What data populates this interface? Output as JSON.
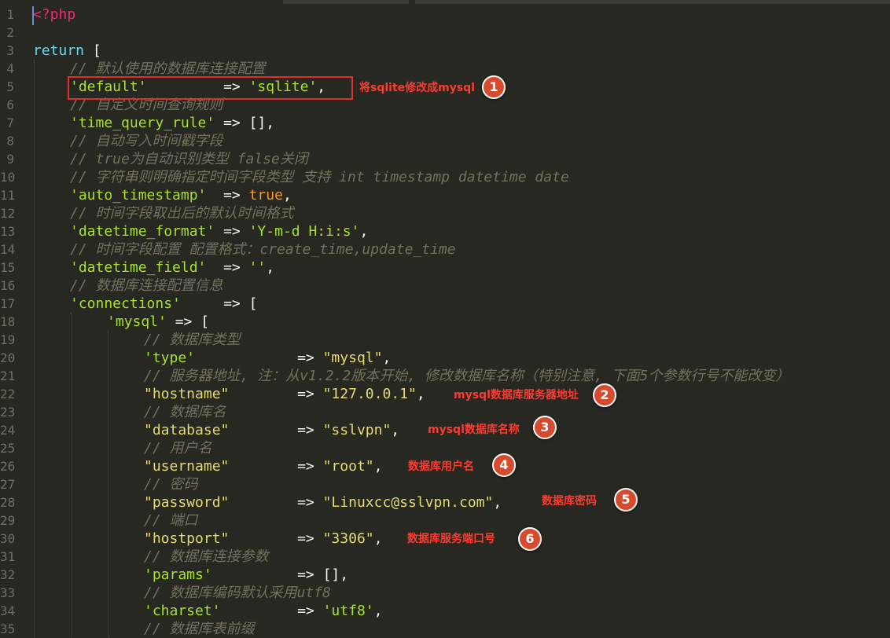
{
  "lines": [
    {
      "n": "1",
      "indent": 0,
      "parts": [
        {
          "t": "<?php",
          "c": "tag"
        }
      ]
    },
    {
      "n": "2",
      "indent": 0,
      "parts": []
    },
    {
      "n": "3",
      "indent": 0,
      "parts": [
        {
          "t": "return",
          "c": "kw"
        },
        {
          "t": " [",
          "c": "op"
        }
      ]
    },
    {
      "n": "4",
      "indent": 1,
      "parts": [
        {
          "t": "// 默认使用的数据库连接配置",
          "c": "cm"
        }
      ]
    },
    {
      "n": "5",
      "indent": 1,
      "parts": [
        {
          "t": "'default'",
          "c": "str"
        },
        {
          "t": "         => ",
          "c": "op"
        },
        {
          "t": "'sqlite'",
          "c": "str"
        },
        {
          "t": ",",
          "c": "op"
        }
      ]
    },
    {
      "n": "6",
      "indent": 1,
      "parts": [
        {
          "t": "// 自定义时间查询规则",
          "c": "cm"
        }
      ]
    },
    {
      "n": "7",
      "indent": 1,
      "parts": [
        {
          "t": "'time_query_rule'",
          "c": "str"
        },
        {
          "t": " => [],",
          "c": "op"
        }
      ]
    },
    {
      "n": "8",
      "indent": 1,
      "parts": [
        {
          "t": "// 自动写入时间戳字段",
          "c": "cm"
        }
      ]
    },
    {
      "n": "9",
      "indent": 1,
      "parts": [
        {
          "t": "// true为自动识别类型 false关闭",
          "c": "cm"
        }
      ]
    },
    {
      "n": "10",
      "indent": 1,
      "parts": [
        {
          "t": "// 字符串则明确指定时间字段类型 支持 int timestamp datetime date",
          "c": "cm"
        }
      ]
    },
    {
      "n": "11",
      "indent": 1,
      "parts": [
        {
          "t": "'auto_timestamp'",
          "c": "str"
        },
        {
          "t": "  => ",
          "c": "op"
        },
        {
          "t": "true",
          "c": "bool"
        },
        {
          "t": ",",
          "c": "op"
        }
      ]
    },
    {
      "n": "12",
      "indent": 1,
      "parts": [
        {
          "t": "// 时间字段取出后的默认时间格式",
          "c": "cm"
        }
      ]
    },
    {
      "n": "13",
      "indent": 1,
      "parts": [
        {
          "t": "'datetime_format'",
          "c": "str"
        },
        {
          "t": " => ",
          "c": "op"
        },
        {
          "t": "'Y-m-d H:i:s'",
          "c": "str"
        },
        {
          "t": ",",
          "c": "op"
        }
      ]
    },
    {
      "n": "14",
      "indent": 1,
      "parts": [
        {
          "t": "// 时间字段配置 配置格式：create_time,update_time",
          "c": "cm"
        }
      ]
    },
    {
      "n": "15",
      "indent": 1,
      "parts": [
        {
          "t": "'datetime_field'",
          "c": "str"
        },
        {
          "t": "  => ",
          "c": "op"
        },
        {
          "t": "''",
          "c": "str"
        },
        {
          "t": ",",
          "c": "op"
        }
      ]
    },
    {
      "n": "16",
      "indent": 1,
      "parts": [
        {
          "t": "// 数据库连接配置信息",
          "c": "cm"
        }
      ]
    },
    {
      "n": "17",
      "indent": 1,
      "parts": [
        {
          "t": "'connections'",
          "c": "str"
        },
        {
          "t": "     => [",
          "c": "op"
        }
      ]
    },
    {
      "n": "18",
      "indent": 2,
      "parts": [
        {
          "t": "'mysql'",
          "c": "str"
        },
        {
          "t": " => [",
          "c": "op"
        }
      ]
    },
    {
      "n": "19",
      "indent": 3,
      "parts": [
        {
          "t": "// 数据库类型",
          "c": "cm"
        }
      ]
    },
    {
      "n": "20",
      "indent": 3,
      "parts": [
        {
          "t": "'type'",
          "c": "str"
        },
        {
          "t": "            => ",
          "c": "op"
        },
        {
          "t": "\"mysql\"",
          "c": "dq"
        },
        {
          "t": ",",
          "c": "op"
        }
      ]
    },
    {
      "n": "21",
      "indent": 3,
      "parts": [
        {
          "t": "// 服务器地址, 注：从v1.2.2版本开始, 修改数据库名称（特别注意, 下面5个参数行号不能改变）",
          "c": "cm"
        }
      ]
    },
    {
      "n": "22",
      "indent": 3,
      "parts": [
        {
          "t": "\"hostname\"",
          "c": "dq"
        },
        {
          "t": "        => ",
          "c": "op"
        },
        {
          "t": "\"127.0.0.1\"",
          "c": "dq"
        },
        {
          "t": ",",
          "c": "op"
        }
      ]
    },
    {
      "n": "23",
      "indent": 3,
      "parts": [
        {
          "t": "// 数据库名",
          "c": "cm"
        }
      ]
    },
    {
      "n": "24",
      "indent": 3,
      "parts": [
        {
          "t": "\"database\"",
          "c": "dq"
        },
        {
          "t": "        => ",
          "c": "op"
        },
        {
          "t": "\"sslvpn\"",
          "c": "dq"
        },
        {
          "t": ",",
          "c": "op"
        }
      ]
    },
    {
      "n": "25",
      "indent": 3,
      "parts": [
        {
          "t": "// 用户名",
          "c": "cm"
        }
      ]
    },
    {
      "n": "26",
      "indent": 3,
      "parts": [
        {
          "t": "\"username\"",
          "c": "dq"
        },
        {
          "t": "        => ",
          "c": "op"
        },
        {
          "t": "\"root\"",
          "c": "dq"
        },
        {
          "t": ",",
          "c": "op"
        }
      ]
    },
    {
      "n": "27",
      "indent": 3,
      "parts": [
        {
          "t": "// 密码",
          "c": "cm"
        }
      ]
    },
    {
      "n": "28",
      "indent": 3,
      "parts": [
        {
          "t": "\"password\"",
          "c": "dq"
        },
        {
          "t": "        => ",
          "c": "op"
        },
        {
          "t": "\"Linuxcc@sslvpn.com\"",
          "c": "dq"
        },
        {
          "t": ",",
          "c": "op"
        }
      ]
    },
    {
      "n": "29",
      "indent": 3,
      "parts": [
        {
          "t": "// 端口",
          "c": "cm"
        }
      ]
    },
    {
      "n": "30",
      "indent": 3,
      "parts": [
        {
          "t": "\"hostport\"",
          "c": "dq"
        },
        {
          "t": "        => ",
          "c": "op"
        },
        {
          "t": "\"3306\"",
          "c": "dq"
        },
        {
          "t": ",",
          "c": "op"
        }
      ]
    },
    {
      "n": "31",
      "indent": 3,
      "parts": [
        {
          "t": "// 数据库连接参数",
          "c": "cm"
        }
      ]
    },
    {
      "n": "32",
      "indent": 3,
      "parts": [
        {
          "t": "'params'",
          "c": "str"
        },
        {
          "t": "          => [],",
          "c": "op"
        }
      ]
    },
    {
      "n": "33",
      "indent": 3,
      "parts": [
        {
          "t": "// 数据库编码默认采用utf8",
          "c": "cm"
        }
      ]
    },
    {
      "n": "34",
      "indent": 3,
      "parts": [
        {
          "t": "'charset'",
          "c": "str"
        },
        {
          "t": "         => ",
          "c": "op"
        },
        {
          "t": "'utf8'",
          "c": "str"
        },
        {
          "t": ",",
          "c": "op"
        }
      ]
    },
    {
      "n": "35",
      "indent": 3,
      "parts": [
        {
          "t": "// 数据库表前缀",
          "c": "cm"
        }
      ]
    }
  ],
  "annotations": [
    {
      "text": "将sqlite修改成mysql",
      "number": "1"
    },
    {
      "text": "mysql数据库服务器地址",
      "number": "2"
    },
    {
      "text": "mysql数据库名称",
      "number": "3"
    },
    {
      "text": "数据库用户名",
      "number": "4"
    },
    {
      "text": "数据库密码",
      "number": "5"
    },
    {
      "text": "数据库服务端口号",
      "number": "6"
    }
  ]
}
